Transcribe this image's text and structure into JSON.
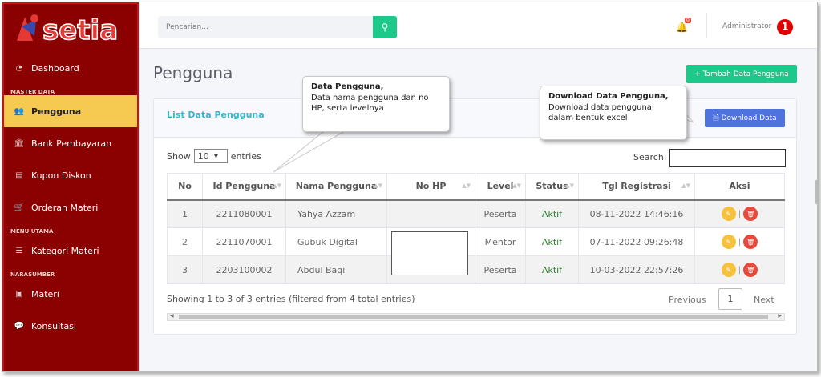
{
  "brand": {
    "logo_text": "setia",
    "logo_color": "#e53935"
  },
  "sidebar": {
    "items": [
      {
        "label": "Dashboard",
        "icon": "dashboard-icon"
      },
      {
        "section": "MASTER DATA"
      },
      {
        "label": "Pengguna",
        "icon": "users-icon",
        "active": true
      },
      {
        "label": "Bank Pembayaran",
        "icon": "bank-icon"
      },
      {
        "label": "Kupon Diskon",
        "icon": "file-icon"
      },
      {
        "label": "Orderan Materi",
        "icon": "cart-icon"
      },
      {
        "section": "MENU UTAMA"
      },
      {
        "label": "Kategori Materi",
        "icon": "list-icon"
      },
      {
        "section": "NARASUMBER"
      },
      {
        "label": "Materi",
        "icon": "book-icon"
      },
      {
        "label": "Konsultasi",
        "icon": "chat-icon"
      }
    ]
  },
  "topbar": {
    "search_placeholder": "Pencarian...",
    "notification_count": "0",
    "user_name": "Administrator",
    "marker": "1"
  },
  "page": {
    "title": "Pengguna",
    "add_button": "+ Tambah Data Pengguna"
  },
  "card": {
    "title": "List Data Pengguna",
    "download_button": "Download Data",
    "show_label": "Show",
    "entries_value": "10",
    "entries_label": "entries",
    "search_label": "Search:"
  },
  "table": {
    "columns": [
      "No",
      "Id Pengguna",
      "Nama Pengguna",
      "No HP",
      "Level",
      "Status",
      "Tgl Registrasi",
      "Aksi"
    ],
    "rows": [
      {
        "no": "1",
        "id": "2211080001",
        "nama": "Yahya Azzam",
        "hp": "",
        "level": "Peserta",
        "status": "Aktif",
        "tgl": "08-11-2022 14:46:16"
      },
      {
        "no": "2",
        "id": "2211070001",
        "nama": "Gubuk Digital",
        "hp": "",
        "level": "Mentor",
        "status": "Aktif",
        "tgl": "07-11-2022 09:26:48"
      },
      {
        "no": "3",
        "id": "2203100002",
        "nama": "Abdul Baqi",
        "hp": "",
        "level": "Peserta",
        "status": "Aktif",
        "tgl": "10-03-2022 22:57:26"
      }
    ]
  },
  "footer": {
    "info": "Showing 1 to 3 of 3 entries (filtered from 4 total entries)",
    "previous": "Previous",
    "page": "1",
    "next": "Next"
  },
  "callouts": {
    "data_title": "Data Pengguna,",
    "data_body": "Data nama pengguna dan no HP, serta levelnya",
    "download_title": "Download Data Pengguna,",
    "download_body": "Download data pengguna dalam bentuk excel"
  },
  "colors": {
    "sidebar_bg": "#8b0000",
    "active_item": "#f6c950",
    "success": "#1cc88a",
    "primary": "#4e73df",
    "info": "#36b9cc",
    "danger": "#e74a3b",
    "warning": "#f6c23e"
  }
}
